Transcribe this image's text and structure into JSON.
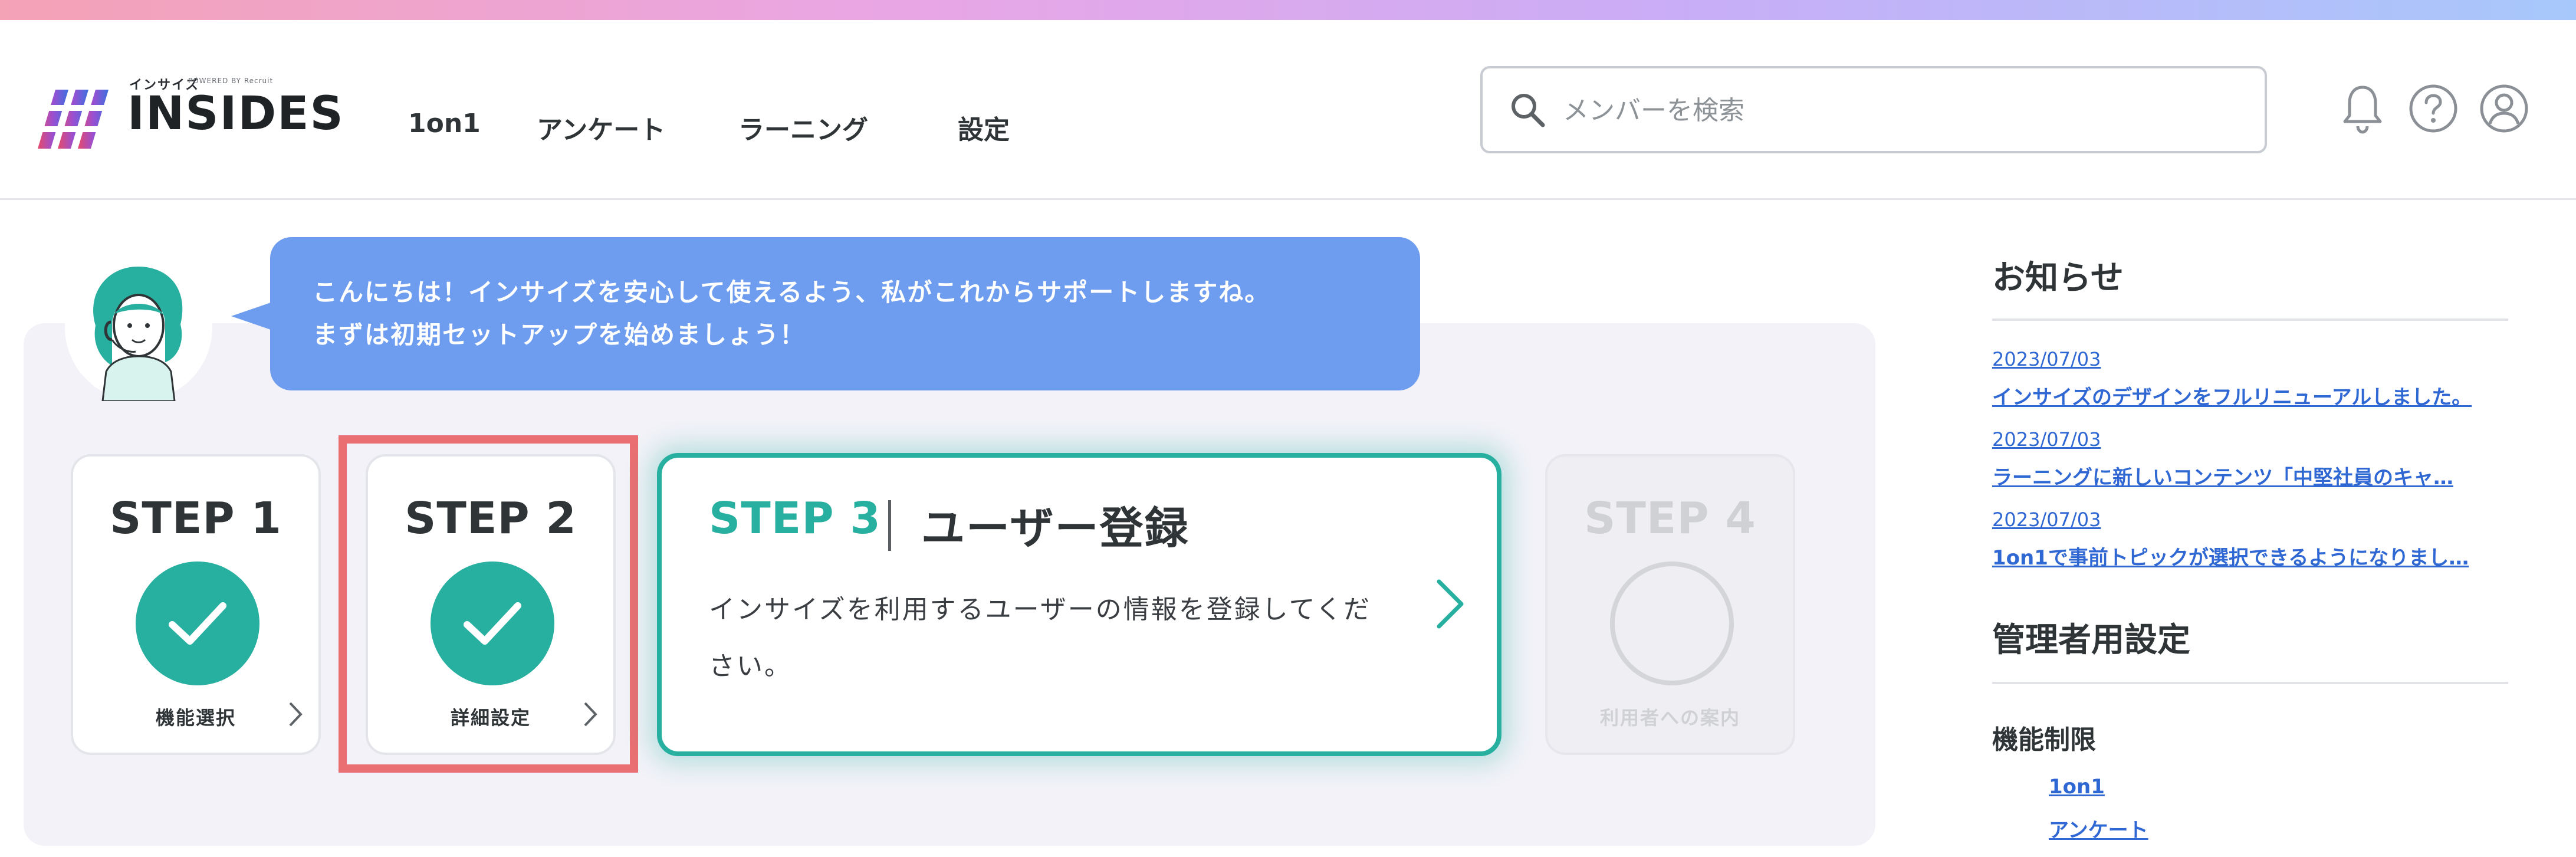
{
  "header": {
    "logo_kana": "インサイズ",
    "logo_powered": "POWERED BY Recruit",
    "logo_text": "INSIDES",
    "nav": [
      "1on1",
      "アンケート",
      "ラーニング",
      "設定"
    ],
    "search_placeholder": "メンバーを検索",
    "icons": [
      "bell-icon",
      "help-icon",
      "user-icon"
    ]
  },
  "welcome": {
    "message_line1": "こんにちは！インサイズを安心して使えるよう、私がこれからサポートしますね。",
    "message_line2": "まずは初期セットアップを始めましょう！"
  },
  "steps": [
    {
      "title": "STEP 1",
      "label": "機能選択",
      "status": "complete"
    },
    {
      "title": "STEP 2",
      "label": "詳細設定",
      "status": "complete"
    },
    {
      "title": "STEP 3",
      "name": "ユーザー登録",
      "description": "インサイズを利用するユーザーの情報を登録してください。",
      "status": "current"
    },
    {
      "title": "STEP 4",
      "label": "利用者への案内",
      "status": "disabled"
    }
  ],
  "news": {
    "heading": "お知らせ",
    "items": [
      {
        "date": "2023/07/03",
        "title": "インサイズのデザインをフルリニューアルしました。"
      },
      {
        "date": "2023/07/03",
        "title": "ラーニングに新しいコンテンツ「中堅社員のキャ…"
      },
      {
        "date": "2023/07/03",
        "title": "1on1で事前トピックが選択できるようになりまし…"
      }
    ]
  },
  "admin": {
    "heading": "管理者用設定",
    "subheading": "機能制限",
    "links": [
      "1on1",
      "アンケート"
    ]
  },
  "colors": {
    "accent": "#27b0a0",
    "bubble": "#6e9df0",
    "link": "#2f67d3",
    "highlight": "#ea6f72"
  }
}
